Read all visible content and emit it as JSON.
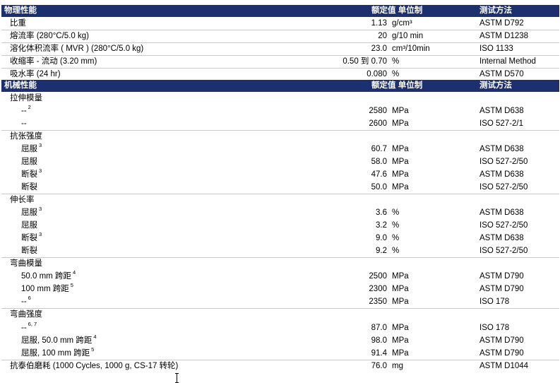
{
  "columns": {
    "value_unit": "额定值 单位制",
    "method": "测试方法"
  },
  "sections": [
    {
      "title": "物理性能",
      "rows": [
        {
          "label": "比重",
          "value": "1.13",
          "unit": "g/cm³",
          "method": "ASTM D792"
        },
        {
          "label": "熔流率 (280°C/5.0 kg)",
          "value": "20",
          "unit": "g/10 min",
          "method": "ASTM D1238"
        },
        {
          "label": "溶化体积流率 ( MVR ) (280°C/5.0 kg)",
          "value": "23.0",
          "unit": "cm³/10min",
          "method": "ISO 1133"
        },
        {
          "label": "收缩率 - 流动 (3.20 mm)",
          "value": "0.50 到 0.70",
          "unit": "%",
          "method": "Internal Method"
        },
        {
          "label": "吸水率 (24 hr)",
          "value": "0.080",
          "unit": "%",
          "method": "ASTM D570"
        }
      ]
    },
    {
      "title": "机械性能",
      "groups": [
        {
          "label": "拉伸模量",
          "rows": [
            {
              "label": "--",
              "note": "2",
              "value": "2580",
              "unit": "MPa",
              "method": "ASTM D638"
            },
            {
              "label": "--",
              "value": "2600",
              "unit": "MPa",
              "method": "ISO 527-2/1"
            }
          ]
        },
        {
          "label": "抗张强度",
          "rows": [
            {
              "label": "屈服",
              "note": "3",
              "value": "60.7",
              "unit": "MPa",
              "method": "ASTM D638"
            },
            {
              "label": "屈服",
              "value": "58.0",
              "unit": "MPa",
              "method": "ISO 527-2/50"
            },
            {
              "label": "断裂",
              "note": "3",
              "value": "47.6",
              "unit": "MPa",
              "method": "ASTM D638"
            },
            {
              "label": "断裂",
              "value": "50.0",
              "unit": "MPa",
              "method": "ISO 527-2/50"
            }
          ]
        },
        {
          "label": "伸长率",
          "rows": [
            {
              "label": "屈服",
              "note": "3",
              "value": "3.6",
              "unit": "%",
              "method": "ASTM D638"
            },
            {
              "label": "屈服",
              "value": "3.2",
              "unit": "%",
              "method": "ISO 527-2/50"
            },
            {
              "label": "断裂",
              "note": "3",
              "value": "9.0",
              "unit": "%",
              "method": "ASTM D638"
            },
            {
              "label": "断裂",
              "value": "9.2",
              "unit": "%",
              "method": "ISO 527-2/50"
            }
          ]
        },
        {
          "label": "弯曲模量",
          "rows": [
            {
              "label": "50.0 mm 跨距",
              "note": "4",
              "value": "2500",
              "unit": "MPa",
              "method": "ASTM D790"
            },
            {
              "label": "100 mm 跨距",
              "note": "5",
              "value": "2300",
              "unit": "MPa",
              "method": "ASTM D790"
            },
            {
              "label": "--",
              "note": "6",
              "value": "2350",
              "unit": "MPa",
              "method": "ISO 178"
            }
          ]
        },
        {
          "label": "弯曲强度",
          "rows": [
            {
              "label": "--",
              "note": "6, 7",
              "value": "87.0",
              "unit": "MPa",
              "method": "ISO 178"
            },
            {
              "label": "屈服, 50.0 mm 跨距",
              "note": "4",
              "value": "98.0",
              "unit": "MPa",
              "method": "ASTM D790"
            },
            {
              "label": "屈服, 100 mm 跨距",
              "note": "5",
              "value": "91.4",
              "unit": "MPa",
              "method": "ASTM D790"
            }
          ]
        }
      ],
      "taber": {
        "label": "抗泰伯磨耗 (1000 Cycles, 1000 g, CS-17 转轮)",
        "value": "76.0",
        "unit": "mg",
        "method": "ASTM D1044"
      }
    }
  ]
}
